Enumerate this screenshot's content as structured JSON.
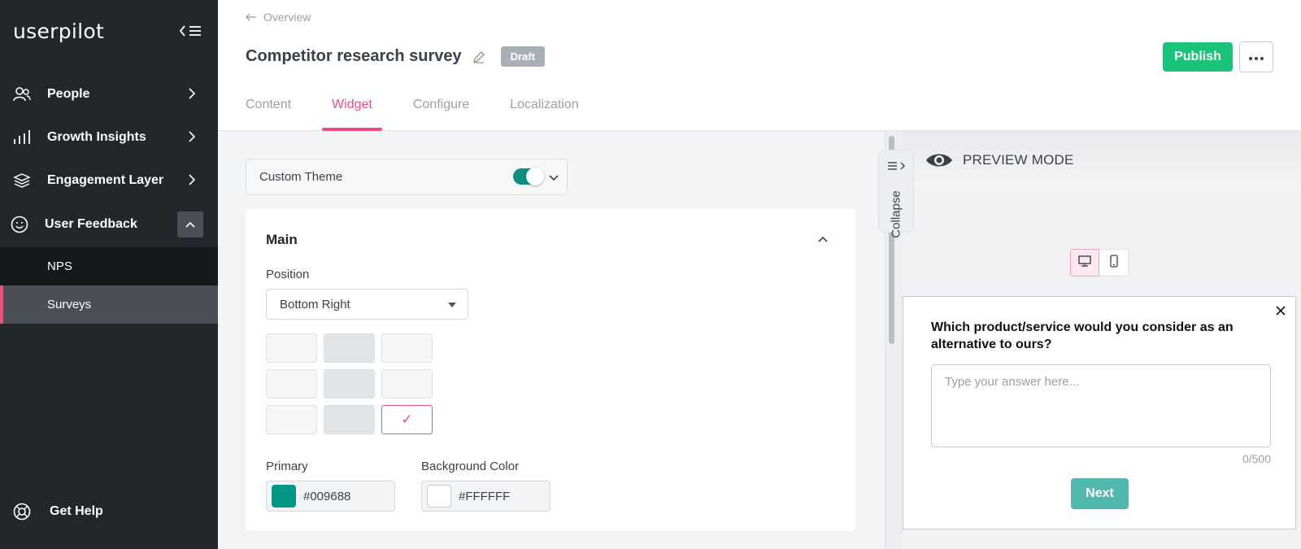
{
  "sidebar": {
    "logo": "userpilot",
    "items": [
      {
        "label": "People",
        "icon": "people-icon"
      },
      {
        "label": "Growth Insights",
        "icon": "bar-chart-icon"
      },
      {
        "label": "Engagement Layer",
        "icon": "layers-icon"
      },
      {
        "label": "User Feedback",
        "icon": "smiley-icon"
      }
    ],
    "sub_items": [
      {
        "label": "NPS"
      },
      {
        "label": "Surveys"
      }
    ],
    "footer": {
      "get_help": "Get Help"
    }
  },
  "header": {
    "breadcrumb": "Overview",
    "title": "Competitor research survey",
    "badge": "Draft",
    "publish_label": "Publish",
    "tabs": [
      {
        "label": "Content"
      },
      {
        "label": "Widget"
      },
      {
        "label": "Configure"
      },
      {
        "label": "Localization"
      }
    ],
    "active_tab": "Widget"
  },
  "widget": {
    "theme_label": "Custom Theme",
    "theme_enabled": true,
    "main_title": "Main",
    "position_label": "Position",
    "position_value": "Bottom Right",
    "selected_cell_mark": "✓",
    "primary_label": "Primary",
    "primary_value": "#009688",
    "background_label": "Background Color",
    "background_value": "#FFFFFF"
  },
  "collapse_label": "Collapse",
  "preview": {
    "mode_label": "PREVIEW MODE",
    "question": "Which product/service would you consider as an alternative to ours?",
    "placeholder": "Type your answer here...",
    "counter": "0/500",
    "next_label": "Next"
  },
  "colors": {
    "accent": "#ec4f7e",
    "publish": "#1bc37a",
    "primary": "#009688",
    "next_button": "#51b8ad",
    "sidebar_bg": "#23262b"
  }
}
